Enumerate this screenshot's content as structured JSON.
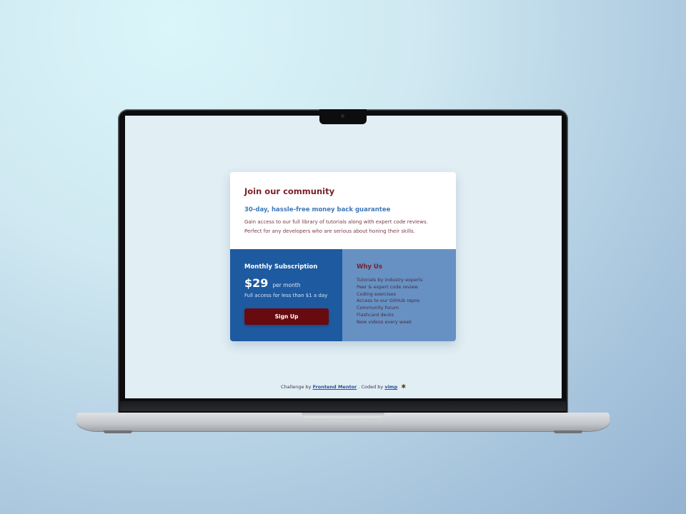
{
  "card": {
    "title": "Join our community",
    "guarantee": "30-day, hassle-free money back guarantee",
    "description": "Gain access to our full library of tutorials along with expert code reviews. Perfect for any developers who are serious about honing their skills.",
    "subscription": {
      "title": "Monthly Subscription",
      "price": "$29",
      "period": "per month",
      "note": "Full access for less than $1 a day",
      "button_label": "Sign Up"
    },
    "why": {
      "title": "Why Us",
      "items": [
        "Tutorials by industry experts",
        "Peer & expert code review",
        "Coding exercises",
        "Access to our GitHub repos",
        "Community forum",
        "Flashcard decks",
        "New videos every week"
      ]
    }
  },
  "attribution": {
    "challenge_prefix": "Challenge by",
    "challenge_link": "Frontend Mentor",
    "coded_prefix": ". Coded by",
    "coder_link": "vimp",
    "icon": "bee-icon"
  },
  "colors": {
    "screen_bg": "#e1eef4",
    "accent_blue": "#1e5aa0",
    "panel_blue": "#6691c2",
    "heading_red": "#7a2028",
    "button_red": "#680b10",
    "link_blue": "#3e78b9"
  }
}
